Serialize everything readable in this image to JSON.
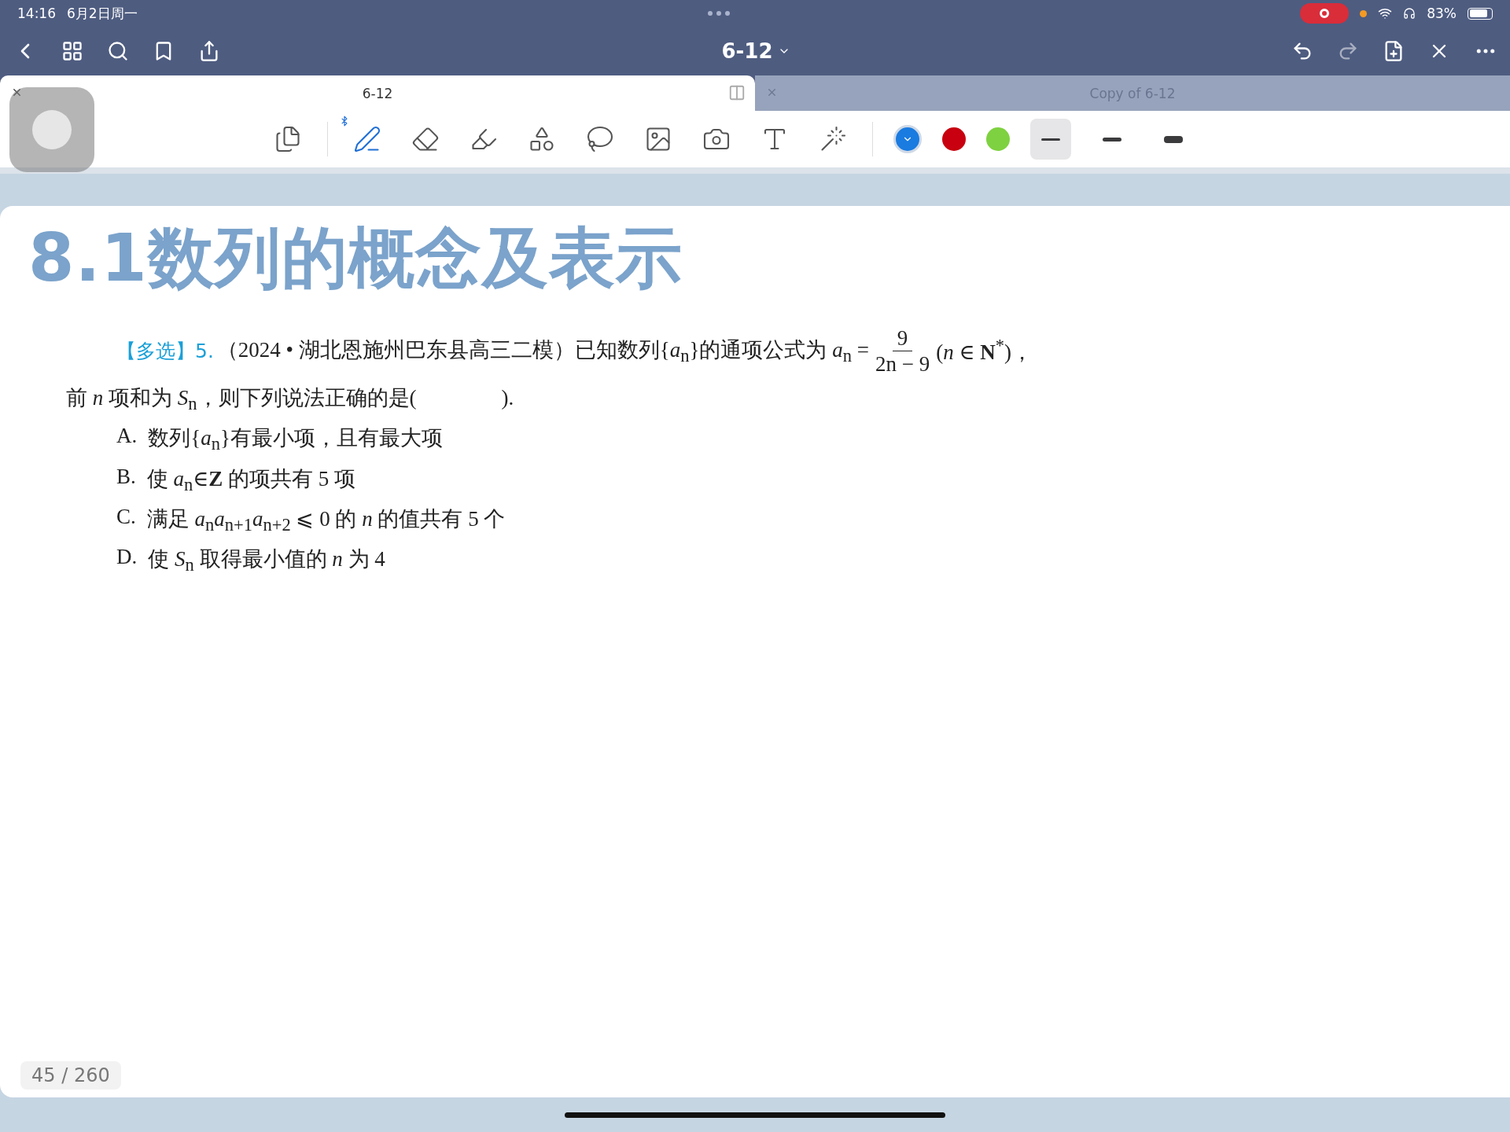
{
  "status_bar": {
    "time": "14:16",
    "date": "6月2日周一",
    "battery": "83%",
    "recording": true
  },
  "nav": {
    "title": "6-12"
  },
  "tabs": [
    {
      "label": "6-12",
      "selected": true
    },
    {
      "label": "Copy of 6-12",
      "selected": false
    }
  ],
  "tools": [
    {
      "kind": "pages",
      "selected": false
    },
    {
      "kind": "pen",
      "selected": true
    },
    {
      "kind": "eraser",
      "selected": false
    },
    {
      "kind": "highlighter",
      "selected": false
    },
    {
      "kind": "shapes",
      "selected": false
    },
    {
      "kind": "lasso",
      "selected": false
    },
    {
      "kind": "image",
      "selected": false
    },
    {
      "kind": "camera",
      "selected": false
    },
    {
      "kind": "text",
      "selected": false
    },
    {
      "kind": "laser",
      "selected": false
    }
  ],
  "colors": [
    {
      "color": "#1a7be0",
      "selected": true
    },
    {
      "color": "#c8000f",
      "selected": false
    },
    {
      "color": "#7ed140",
      "selected": false
    }
  ],
  "widths": [
    {
      "kind": "thin",
      "selected": true
    },
    {
      "kind": "medium",
      "selected": false
    },
    {
      "kind": "thick",
      "selected": false
    }
  ],
  "page": {
    "heading": "8.1数列的概念及表示",
    "question": {
      "tag": "【多选】5.",
      "source": "（2024 • 湖北恩施州巴东县高三二模）已知数列{*a*$_{n}$}的通项公式为 *a*$_{n}$ =",
      "numerator": "9",
      "denominator": "2n − 9",
      "after": "(*n* ∈ **N**$^{*}$)，",
      "line2": "前 *n* 项和为 *S*$_{n}$，则下列说法正确的是(　　　　)."
    },
    "options": [
      {
        "label": "A.",
        "text": "数列{*a*$_{n}$}有最小项，且有最大项"
      },
      {
        "label": "B.",
        "text": "使 *a*$_{n}$∈**Z** 的项共有 5 项"
      },
      {
        "label": "C.",
        "text": "满足 *a*$_{n}$*a*$_{n+1}$*a*$_{n+2}$ ⩽ 0 的 *n* 的值共有 5 个"
      },
      {
        "label": "D.",
        "text": "使 *S*$_{n}$ 取得最小值的 *n* 为 4"
      }
    ],
    "page_number": "45 / 260"
  }
}
